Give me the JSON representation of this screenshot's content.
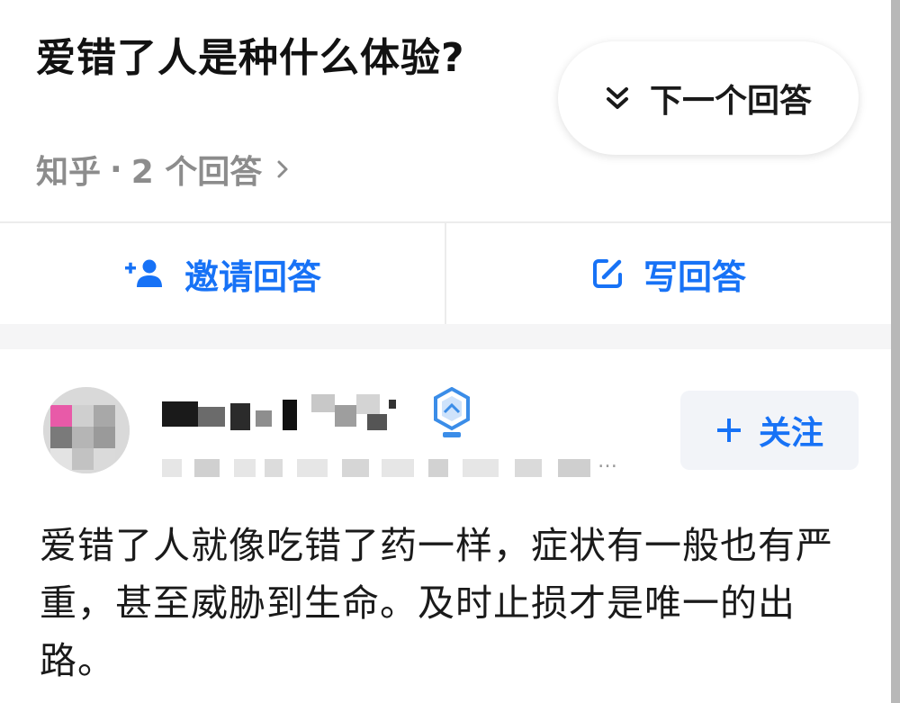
{
  "question": {
    "title": "爱错了人是种什么体验?",
    "source": "知乎",
    "separator": "·",
    "answer_count_text": "2 个回答"
  },
  "next_answer": {
    "label": "下一个回答",
    "icon": "double-chevron-down-icon"
  },
  "actions": {
    "invite_label": "邀请回答",
    "invite_icon": "add-user-icon",
    "write_label": "写回答",
    "write_icon": "edit-icon"
  },
  "answer": {
    "author_verified_icon": "verified-badge-icon",
    "follow_label": "关注",
    "follow_icon": "plus-icon",
    "excerpt": "爱错了人就像吃错了药一样，症状有一般也有严重，甚至威胁到生命。及时止损才是唯一的出路。"
  },
  "colors": {
    "accent": "#1772f6",
    "muted_text": "#8c8c8c",
    "divider": "#ececec"
  }
}
